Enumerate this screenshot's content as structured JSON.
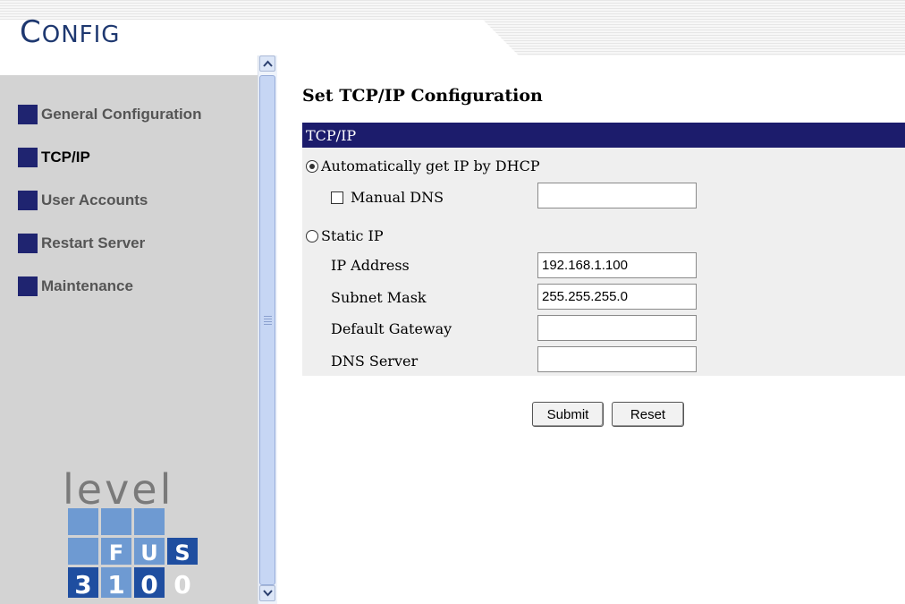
{
  "header": {
    "logo_first": "C",
    "logo_rest": "ONFIG"
  },
  "sidebar": {
    "items": [
      {
        "label": "General Configuration",
        "active": false
      },
      {
        "label": "TCP/IP",
        "active": true
      },
      {
        "label": "User Accounts",
        "active": false
      },
      {
        "label": "Restart Server",
        "active": false
      },
      {
        "label": "Maintenance",
        "active": false
      }
    ],
    "nav_square_color": "#1f2470",
    "brand_word": "level",
    "brand_grid": {
      "row1": [
        "",
        "",
        ""
      ],
      "row2": [
        "F",
        "U",
        "S"
      ],
      "row3": [
        "3",
        "1",
        "0",
        "0"
      ]
    }
  },
  "main": {
    "title": "Set TCP/IP Configuration",
    "panel_header": "TCP/IP",
    "panel_header_color": "#1c1c6c",
    "dhcp_label": "Automatically get IP by DHCP",
    "dhcp_selected": true,
    "manual_dns_label": "Manual DNS",
    "manual_dns_checked": false,
    "manual_dns_value": "",
    "static_label": "Static IP",
    "static_selected": false,
    "fields": {
      "ip_address": {
        "label": "IP Address",
        "value": "192.168.1.100"
      },
      "subnet_mask": {
        "label": "Subnet Mask",
        "value": "255.255.255.0"
      },
      "default_gateway": {
        "label": "Default Gateway",
        "value": ""
      },
      "dns_server": {
        "label": "DNS Server",
        "value": ""
      }
    },
    "submit_label": "Submit",
    "reset_label": "Reset"
  }
}
